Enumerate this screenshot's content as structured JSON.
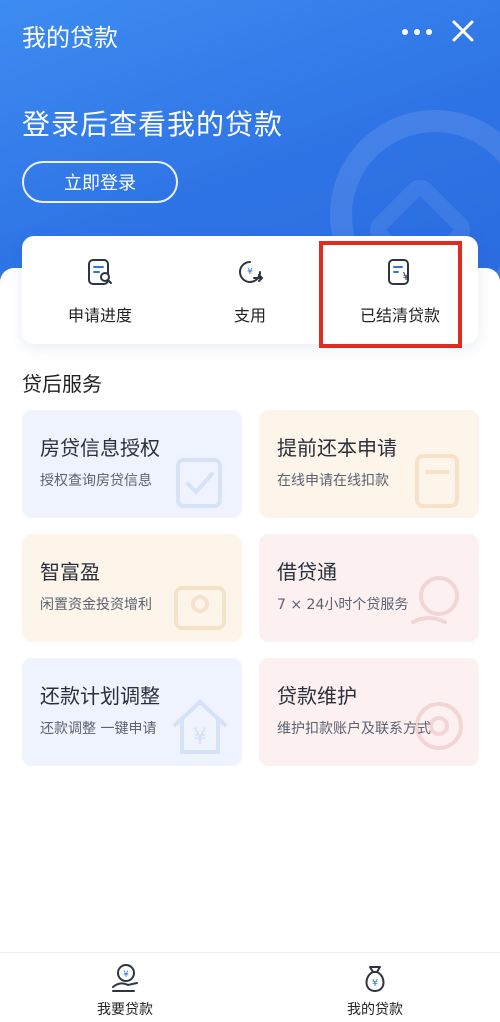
{
  "header": {
    "title": "我的贷款",
    "headline": "登录后查看我的贷款",
    "login_label": "立即登录"
  },
  "quick_actions": [
    {
      "label": "申请进度",
      "icon": "document-search-icon"
    },
    {
      "label": "支用",
      "icon": "yuan-circle-arrow-icon"
    },
    {
      "label": "已结清贷款",
      "icon": "document-yuan-icon"
    }
  ],
  "section": {
    "title": "贷后服务"
  },
  "services": [
    {
      "title": "房贷信息授权",
      "subtitle": "授权查询房贷信息",
      "theme": "blue"
    },
    {
      "title": "提前还本申请",
      "subtitle": "在线申请在线扣款",
      "theme": "orange"
    },
    {
      "title": "智富盈",
      "subtitle": "闲置资金投资增利",
      "theme": "orange"
    },
    {
      "title": "借贷通",
      "subtitle": "7 × 24小时个贷服务",
      "theme": "pink"
    },
    {
      "title": "还款计划调整",
      "subtitle": "还款调整 一键申请",
      "theme": "blue"
    },
    {
      "title": "贷款维护",
      "subtitle": "维护扣款账户及联系方式",
      "theme": "pink"
    }
  ],
  "tabs": [
    {
      "label": "我要贷款",
      "icon": "hand-coin-icon"
    },
    {
      "label": "我的贷款",
      "icon": "money-bag-icon"
    }
  ],
  "colors": {
    "brand": "#2f74e6",
    "highlight": "#e02b20"
  }
}
